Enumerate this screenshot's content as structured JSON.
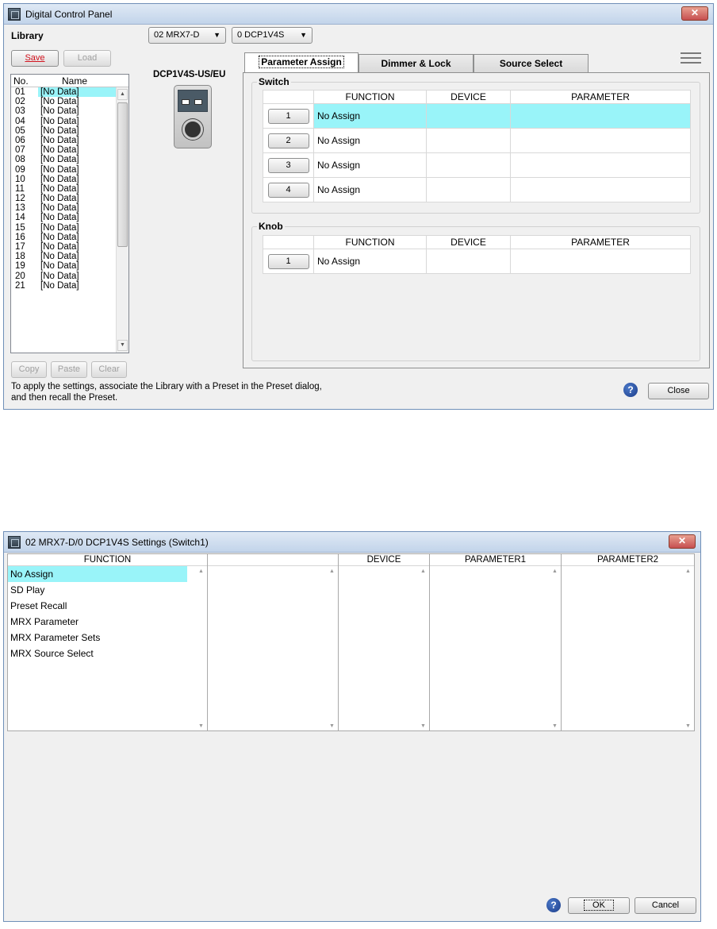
{
  "panel": {
    "title": "Digital Control Panel",
    "library_label": "Library",
    "device_dropdown": "02 MRX7-D",
    "panel_dropdown": "0 DCP1V4S",
    "save_label": "Save",
    "load_label": "Load",
    "list_header_no": "No.",
    "list_header_name": "Name",
    "library_items": [
      {
        "no": "01",
        "name": "[No Data]"
      },
      {
        "no": "02",
        "name": "[No Data]"
      },
      {
        "no": "03",
        "name": "[No Data]"
      },
      {
        "no": "04",
        "name": "[No Data]"
      },
      {
        "no": "05",
        "name": "[No Data]"
      },
      {
        "no": "06",
        "name": "[No Data]"
      },
      {
        "no": "07",
        "name": "[No Data]"
      },
      {
        "no": "08",
        "name": "[No Data]"
      },
      {
        "no": "09",
        "name": "[No Data]"
      },
      {
        "no": "10",
        "name": "[No Data]"
      },
      {
        "no": "11",
        "name": "[No Data]"
      },
      {
        "no": "12",
        "name": "[No Data]"
      },
      {
        "no": "13",
        "name": "[No Data]"
      },
      {
        "no": "14",
        "name": "[No Data]"
      },
      {
        "no": "15",
        "name": "[No Data]"
      },
      {
        "no": "16",
        "name": "[No Data]"
      },
      {
        "no": "17",
        "name": "[No Data]"
      },
      {
        "no": "18",
        "name": "[No Data]"
      },
      {
        "no": "19",
        "name": "[No Data]"
      },
      {
        "no": "20",
        "name": "[No Data]"
      },
      {
        "no": "21",
        "name": "[No Data]"
      }
    ],
    "copy_label": "Copy",
    "paste_label": "Paste",
    "clear_label": "Clear",
    "device_model": "DCP1V4S-US/EU",
    "tabs": [
      "Parameter Assign",
      "Dimmer & Lock",
      "Source Select"
    ],
    "switch_group": "Switch",
    "knob_group": "Knob",
    "col_function": "FUNCTION",
    "col_device": "DEVICE",
    "col_parameter": "PARAMETER",
    "switch_rows": [
      {
        "btn": "1",
        "function": "No Assign",
        "device": "",
        "parameter": ""
      },
      {
        "btn": "2",
        "function": "No Assign",
        "device": "",
        "parameter": ""
      },
      {
        "btn": "3",
        "function": "No Assign",
        "device": "",
        "parameter": ""
      },
      {
        "btn": "4",
        "function": "No Assign",
        "device": "",
        "parameter": ""
      }
    ],
    "knob_rows": [
      {
        "btn": "1",
        "function": "No Assign",
        "device": "",
        "parameter": ""
      }
    ],
    "footnote_line1": "To apply the settings, associate the Library with a Preset in the Preset dialog,",
    "footnote_line2": "and then recall the Preset.",
    "close_label": "Close"
  },
  "settings": {
    "title": "02 MRX7-D/0 DCP1V4S Settings (Switch1)",
    "col_function": "FUNCTION",
    "col_blank": "",
    "col_device": "DEVICE",
    "col_parameter1": "PARAMETER1",
    "col_parameter2": "PARAMETER2",
    "functions": [
      "No Assign",
      "SD Play",
      "Preset Recall",
      "MRX Parameter",
      "MRX Parameter Sets",
      "MRX Source Select"
    ],
    "ok_label": "OK",
    "cancel_label": "Cancel"
  },
  "colors": {
    "selection": "#99f4f9",
    "save_text": "#d2131e",
    "window_bg": "#f0f0f0"
  }
}
